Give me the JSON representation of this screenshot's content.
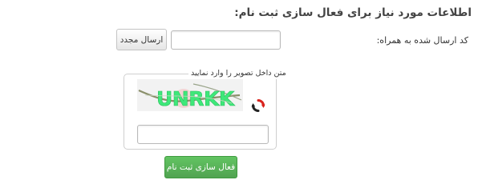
{
  "page": {
    "heading": "اطلاعات مورد نیاز برای فعال سازی ثبت نام:"
  },
  "code_section": {
    "label": "کد ارسال شده به همراه:",
    "input_value": "",
    "resend_label": "ارسال مجدد"
  },
  "captcha": {
    "legend": "متن داخل تصویر را وارد نمایید",
    "image_text": "UNRKK",
    "input_value": "",
    "refresh_icon": "refresh-icon"
  },
  "actions": {
    "activate_label": "فعال سازی ثبت نام"
  },
  "colors": {
    "activate_button": "#5bb75b",
    "captcha_text": "#3ee87a",
    "refresh_red": "#d9231d",
    "refresh_dark": "#222222"
  }
}
